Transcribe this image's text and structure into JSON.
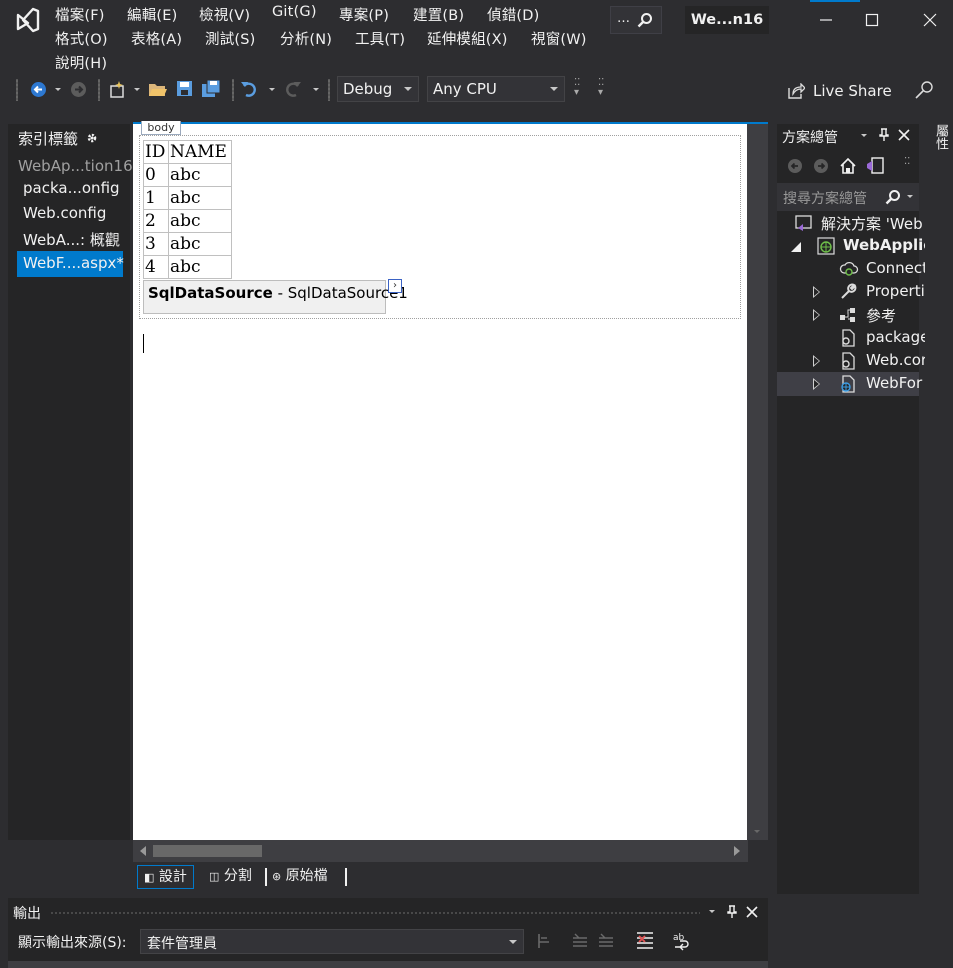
{
  "menu": {
    "row1": [
      "檔案(F)",
      "編輯(E)",
      "檢視(V)",
      "Git(G)",
      "專案(P)",
      "建置(B)",
      "偵錯(D)"
    ],
    "row2": [
      "格式(O)",
      "表格(A)",
      "測試(S)",
      "分析(N)",
      "工具(T)",
      "延伸模組(X)",
      "視窗(W)"
    ],
    "row3": [
      "說明(H)"
    ]
  },
  "title": {
    "search_label": "…",
    "window_title": "We...n16"
  },
  "toolbar": {
    "config": "Debug",
    "platform": "Any CPU",
    "live_share": "Live Share"
  },
  "left_panel": {
    "title": "索引標籤",
    "group": "WebAp...tion16",
    "items": [
      "packa...onfig",
      "Web.config",
      "WebA...: 概觀",
      "WebF....aspx*"
    ],
    "selected_index": 3
  },
  "designer": {
    "body_tag": "body",
    "table": {
      "headers": [
        "ID",
        "NAME"
      ],
      "rows": [
        [
          "0",
          "abc"
        ],
        [
          "1",
          "abc"
        ],
        [
          "2",
          "abc"
        ],
        [
          "3",
          "abc"
        ],
        [
          "4",
          "abc"
        ]
      ]
    },
    "datasource_type": "SqlDataSource",
    "datasource_name": " - SqlDataSource1",
    "smart_tag": "›"
  },
  "view_tabs": [
    "設計",
    "分割",
    "原始檔"
  ],
  "solution_explorer": {
    "title": "方案總管",
    "search_placeholder": "搜尋方案總管",
    "solution": "解決方案 'Web",
    "project": "WebApplic",
    "nodes": [
      "Connect",
      "Properti",
      "參考",
      "package",
      "Web.cor",
      "WebFor"
    ]
  },
  "right_strip_label": "屬性",
  "output": {
    "title": "輸出",
    "source_label": "顯示輸出來源(S):",
    "source_value": "套件管理員"
  },
  "colors": {
    "accent": "#007acc",
    "background": "#2d2d30",
    "panel": "#252526"
  }
}
